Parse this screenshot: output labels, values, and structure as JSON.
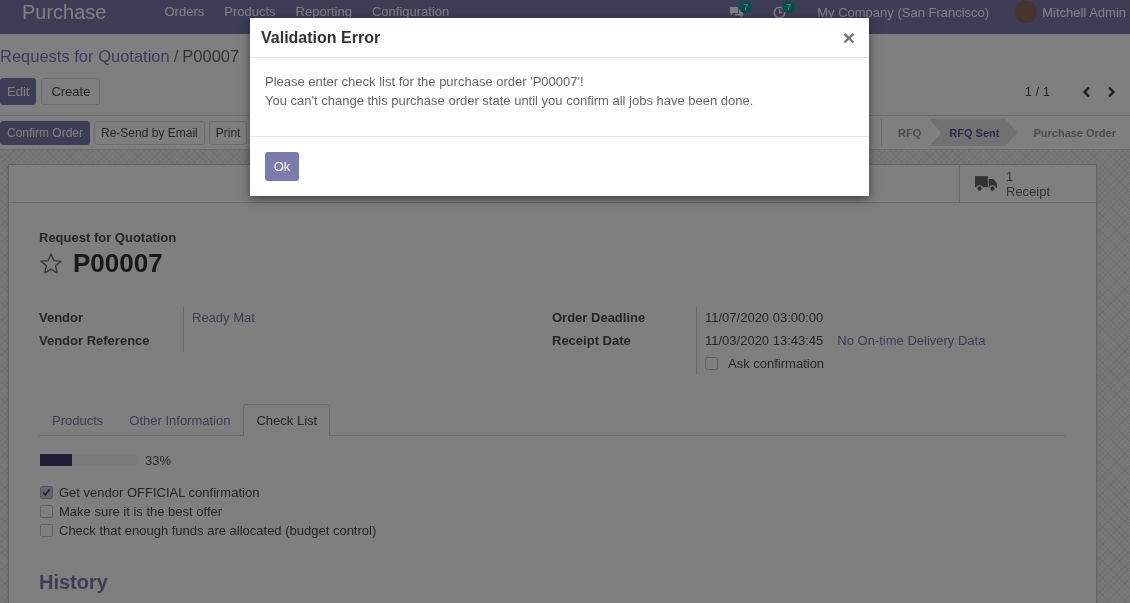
{
  "navbar": {
    "app_name": "Purchase",
    "menu": [
      "Orders",
      "Products",
      "Reporting",
      "Configuration"
    ],
    "messages_badge": "7",
    "activities_badge": "7",
    "company": "My Company (San Francisco)",
    "user": "Mitchell Admin"
  },
  "breadcrumb": [
    "Requests for Quotation",
    "P00007"
  ],
  "breadcrumb_separator": "/",
  "actions": [
    {
      "label": "Edit",
      "primary": true
    },
    {
      "label": "Create",
      "primary": false
    }
  ],
  "pager": "1 / 1",
  "header_buttons": [
    {
      "label": "Confirm Order",
      "primary": true
    },
    {
      "label": "Re-Send by Email",
      "primary": false
    },
    {
      "label": "Print",
      "primary": false
    }
  ],
  "statusbar": [
    {
      "label": "RFQ",
      "selected": false
    },
    {
      "label": "RFQ Sent",
      "selected": true
    },
    {
      "label": "Purchase Order",
      "selected": false
    }
  ],
  "smart_button": {
    "count": "1",
    "label": "Receipt"
  },
  "title": {
    "subtitle": "Request for Quotation",
    "name": "P00007",
    "starred": false
  },
  "left_fields": [
    {
      "label": "Vendor",
      "value": "Ready Mat",
      "kind": "link"
    },
    {
      "label": "Vendor Reference"
    }
  ],
  "right_fields": [
    {
      "label": "Order Deadline",
      "value": "11/07/2020 03:00:00"
    },
    {
      "label": "Receipt Date",
      "value": "11/03/2020 13:43:45",
      "note": "No On-time Delivery Data"
    }
  ],
  "ask_confirmation": {
    "label": "Ask confirmation",
    "checked": false
  },
  "tabs": [
    {
      "label": "Products",
      "selected": false
    },
    {
      "label": "Other Information",
      "selected": false
    },
    {
      "label": "Check List",
      "selected": true
    }
  ],
  "checklist": {
    "level": 0.33,
    "reading": "33%",
    "items": [
      {
        "label": "Get vendor OFFICIAL confirmation",
        "checked": true
      },
      {
        "label": "Make sure it is the best offer",
        "checked": false
      },
      {
        "label": "Check that enough funds are allocated (budget control)",
        "checked": false
      }
    ]
  },
  "history_heading": "History",
  "dialog": {
    "title": "Validation Error",
    "close": "×",
    "lines": [
      "Please enter check list for the purchase order 'P00007'!",
      "You can't change this purchase order state until you confirm all jobs have been done."
    ],
    "button": "Ok"
  }
}
